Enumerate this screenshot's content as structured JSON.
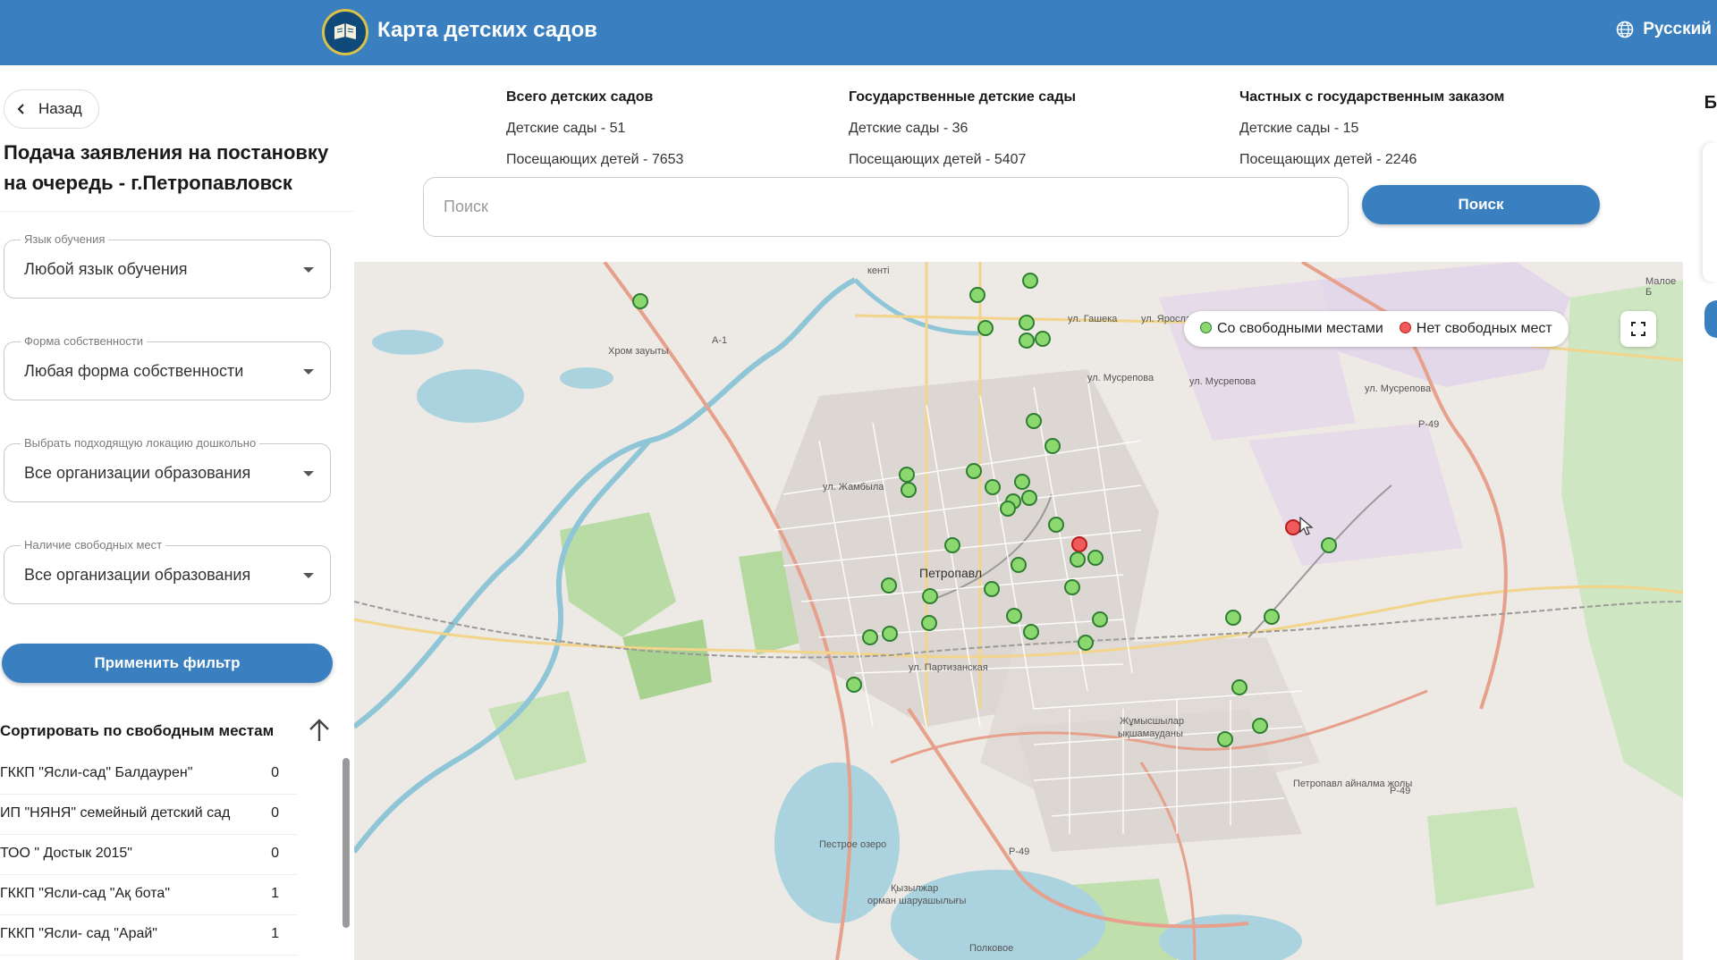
{
  "header": {
    "title": "Карта детских садов",
    "language": "Русский"
  },
  "sidebar": {
    "back_label": "Назад",
    "title": "Подача заявления на постановку на очередь - г.Петропавловск",
    "filters": [
      {
        "label": "Язык обучения",
        "value": "Любой язык обучения"
      },
      {
        "label": "Форма собственности",
        "value": "Любая форма собственности"
      },
      {
        "label": "Выбрать подходящую локацию дошкольно",
        "value": "Все организации образования"
      },
      {
        "label": "Наличие свободных мест",
        "value": "Все организации образования"
      }
    ],
    "apply_label": "Применить фильтр",
    "sort_label": "Сортировать по свободным местам",
    "list": [
      {
        "name": "ГККП \"Ясли-сад\" Балдаурен\"",
        "count": "0"
      },
      {
        "name": "ИП \"НЯНЯ\" семейный детский сад",
        "count": "0"
      },
      {
        "name": "ТОО \" Достык 2015\"",
        "count": "0"
      },
      {
        "name": "ГККП \"Ясли-сад \"Ақ бота\"",
        "count": "1"
      },
      {
        "name": "ГККП \"Ясли- сад \"Арай\"",
        "count": "1"
      }
    ]
  },
  "stats": [
    {
      "title": "Всего детских садов",
      "line1": "Детские сады - 51",
      "line2": "Посещающих детей - 7653"
    },
    {
      "title": "Государственные детские сады",
      "line1": "Детские сады - 36",
      "line2": "Посещающих детей - 5407"
    },
    {
      "title": "Частных с государственным заказом",
      "line1": "Детские сады - 15",
      "line2": "Посещающих детей - 2246"
    }
  ],
  "stats_edge_letter": "Б",
  "search": {
    "placeholder": "Поиск",
    "button_label": "Поиск"
  },
  "map": {
    "legend": {
      "free": "Со свободными местами",
      "none": "Нет свободных мест"
    },
    "colors": {
      "free": "#8bd86f",
      "none": "#f15a5a"
    },
    "labels": {
      "city": "Петропавл",
      "district": "Жұмысшылар",
      "district2": "ықшамауданы",
      "area1": "Хром зауыты",
      "area2": "Қызылжар",
      "area3": "орман шаруашылығы",
      "kenti": "кенті",
      "maloe": "Малое Б",
      "a1": "А-1",
      "p49a": "Р-49",
      "p49b": "Р-49",
      "p49c": "Р-49",
      "street1": "ул. Гашека",
      "street2": "ул. Ярослава Гашека",
      "street3": "ул. Мусрепова",
      "street4": "ул. Мусрепова",
      "street5": "ул. Мусрепова",
      "street6": "Петропавл айналма жолы",
      "street7": "ул. Жамбыла",
      "street8": "ул. Партизанская",
      "lake1": "Пестрое озеро",
      "lake2": "Полковое"
    }
  }
}
